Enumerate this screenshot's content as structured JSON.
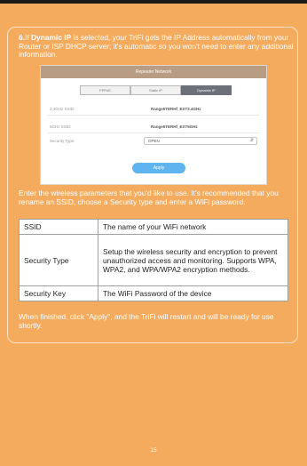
{
  "step": {
    "number": "6.",
    "pre": "If ",
    "bold": "Dynamic IP",
    "rest": " is selected, your TriFi gets the IP Address automatically from your Router or ISP DHCP server; it's automatic so you won't need to enter any additional information."
  },
  "screenshot": {
    "title": "Repeater Network",
    "tabs": [
      "PPPoE",
      "Static IP",
      "Dynamic IP"
    ],
    "active_tab": 2,
    "rows": [
      {
        "label": "2.4GHz SSID:",
        "value": "Range5TERHf_EXT2.4GHz"
      },
      {
        "label": "5GHz SSID:",
        "value": "Range5TERHf_EXT5GHz"
      }
    ],
    "security_label": "Security Type:",
    "security_value": "OPEN",
    "apply_label": "Apply"
  },
  "intro": "Enter the wireless parameters that you'd like to use. It's recommended that you rename an SSID, choose a Security type and enter a WiFi password.",
  "table": [
    {
      "key": "SSID",
      "value": "The name of your WiFi network"
    },
    {
      "key": "Security Type",
      "value": "Setup the wireless security and encryption to prevent unauthorized access and monitoring. Supports WPA, WPA2, and WPA/WPA2 encryption methods."
    },
    {
      "key": "Security Key",
      "value": "The WiFi Password of the device"
    }
  ],
  "outro": "When finished, click \"Apply\", and the TriFi will restart and will be ready for use shortly.",
  "page_number": "15"
}
